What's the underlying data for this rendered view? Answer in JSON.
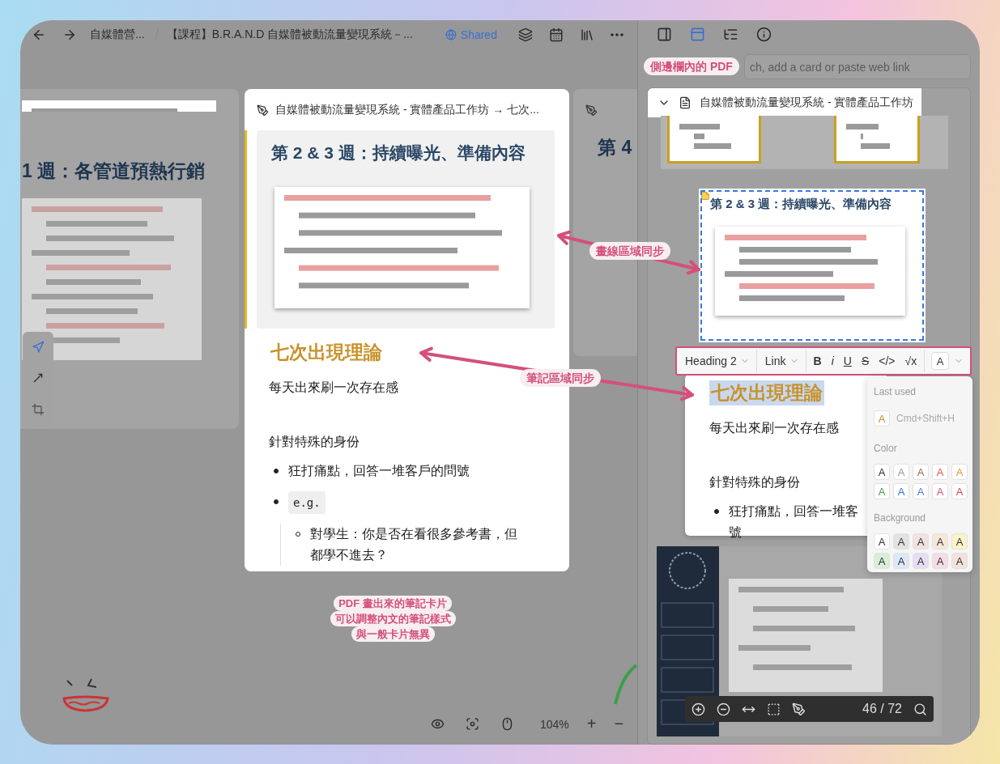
{
  "topbar": {
    "breadcrumbs": [
      "自媒體營...",
      "【課程】B.R.A.N.D 自媒體被動流量變現系統－..."
    ],
    "shared": "Shared"
  },
  "canvas": {
    "left_card": {
      "heading": "1 週：各管道預熱行銷"
    },
    "center_card": {
      "source": "自媒體被動流量變現系統 - 實體產品工作坊 → 七次...",
      "pdf_heading": "第 2 & 3 週：持續曝光、準備內容",
      "heading": "七次出現理論",
      "blocks": [
        {
          "kind": "paragraph",
          "text": "每天出來刷一次存在感"
        },
        {
          "kind": "paragraph",
          "text": "針對特殊的身份"
        },
        {
          "kind": "bullet",
          "text": "狂打痛點，回答一堆客戶的問號"
        },
        {
          "kind": "code_bullet",
          "text": "e.g."
        },
        {
          "kind": "sub_bullet",
          "text": "對學生：你是否在看很多參考書，但都學不進去？"
        }
      ]
    },
    "right_card": {
      "heading": "第 4"
    },
    "zoom": {
      "value": "104%",
      "zoom_in": "+",
      "zoom_out": "−"
    }
  },
  "annotations": {
    "sidebar_pdf": "側邊欄內的 PDF",
    "drawing_sync": "畫線區域同步",
    "note_sync": "筆記區域同步",
    "caption": [
      "PDF 畫出來的筆記卡片",
      "可以調整內文的筆記樣式",
      "與一般卡片無異"
    ]
  },
  "sidebar": {
    "tabs": [
      {
        "kind": "panel",
        "selected": false
      },
      {
        "kind": "cards",
        "selected": true
      },
      {
        "kind": "outline",
        "selected": false
      },
      {
        "kind": "info",
        "selected": false
      }
    ],
    "search": {
      "placeholder": "ch, add a card or paste web link"
    },
    "pdf": {
      "title": "自媒體被動流量變現系統 - 實體產品工作坊",
      "expanded": true,
      "page_heading": "第 2 & 3 週：持續曝光、準備內容",
      "page_indicator": "46 / 72"
    },
    "note_editor": {
      "toolbar": {
        "block_type": "Heading 2",
        "link": "Link",
        "marks": [
          {
            "kind": "bold",
            "label": "B"
          },
          {
            "kind": "italic",
            "label": "i"
          },
          {
            "kind": "underline",
            "label": "U"
          },
          {
            "kind": "strike",
            "label": "S"
          },
          {
            "kind": "code",
            "label": "</>"
          },
          {
            "kind": "math",
            "label": "√x"
          }
        ],
        "color_button": "A"
      },
      "heading": "七次出現理論",
      "blocks": [
        {
          "kind": "paragraph",
          "text": "每天出來刷一次存在感"
        },
        {
          "kind": "paragraph",
          "text": "針對特殊的身份"
        },
        {
          "kind": "bullet",
          "text": "狂打痛點，回答一堆客",
          "continuation": "號"
        }
      ]
    },
    "color_menu": {
      "last_used_title": "Last used",
      "last_used": {
        "label": "A",
        "color": "#d08a2a",
        "shortcut": "Cmd+Shift+H"
      },
      "color_title": "Color",
      "colors": [
        {
          "label": "A",
          "color": "#333333"
        },
        {
          "label": "A",
          "color": "#9a9a9a"
        },
        {
          "label": "A",
          "color": "#9b6b55"
        },
        {
          "label": "A",
          "color": "#e05a3a"
        },
        {
          "label": "A",
          "color": "#d9a030"
        },
        {
          "label": "A",
          "color": "#3f9a4a"
        },
        {
          "label": "A",
          "color": "#2f6fe8"
        },
        {
          "label": "A",
          "color": "#4a7be8"
        },
        {
          "label": "A",
          "color": "#d94f7a"
        },
        {
          "label": "A",
          "color": "#e04545"
        }
      ],
      "background_title": "Background",
      "backgrounds": [
        {
          "label": "A",
          "color": "#ffffff"
        },
        {
          "label": "A",
          "color": "#e2e2e2"
        },
        {
          "label": "A",
          "color": "#f1e1e1"
        },
        {
          "label": "A",
          "color": "#f6e8d8"
        },
        {
          "label": "A",
          "color": "#fcf2c8"
        },
        {
          "label": "A",
          "color": "#d6efd9"
        },
        {
          "label": "A",
          "color": "#dce8f7"
        },
        {
          "label": "A",
          "color": "#e6dcf5"
        },
        {
          "label": "A",
          "color": "#f5dce6"
        },
        {
          "label": "A",
          "color": "#f5e0e0"
        }
      ]
    }
  }
}
